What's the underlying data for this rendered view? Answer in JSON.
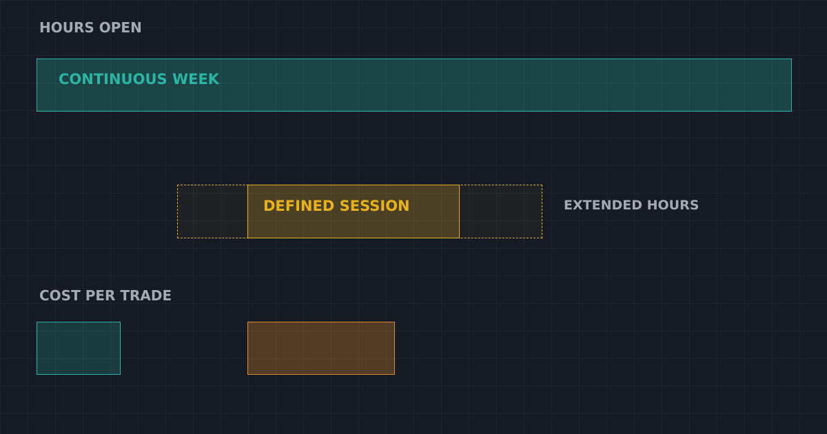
{
  "hours_open": {
    "label": "HOURS OPEN",
    "continuous": {
      "label": "CONTINUOUS WEEK",
      "color": "#2bb3a3"
    },
    "session": {
      "label": "DEFINED SESSION",
      "color": "#e3b023"
    },
    "extended": {
      "label": "EXTENDED HOURS",
      "color": "#e3b023"
    }
  },
  "cost_per_trade": {
    "label": "COST PER TRADE",
    "left_color": "#2bb3a3",
    "right_color": "#e08a2c"
  },
  "colors": {
    "background": "#161a24",
    "label_gray": "#a4a9b4"
  }
}
